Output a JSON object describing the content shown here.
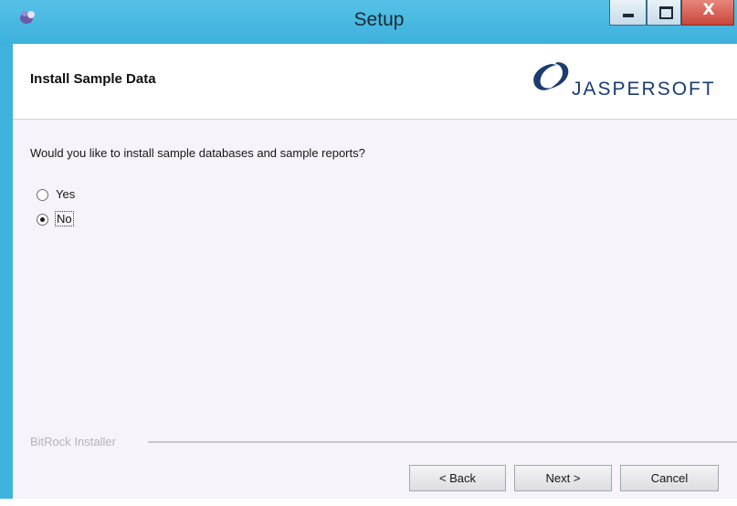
{
  "window": {
    "title": "Setup",
    "close_glyph": "X",
    "app_icon": "installer-app-icon",
    "colors": {
      "titlebar": "#3db1dd",
      "close_button": "#c9463a",
      "body": "#f6f3fa"
    }
  },
  "header": {
    "title": "Install Sample Data",
    "logo_text": "JASPERSOFT",
    "logo_icon": "jaspersoft-swirl-logo",
    "logo_color": "#1a3c6e"
  },
  "content": {
    "question": "Would you like to install sample databases and sample reports?",
    "options": [
      {
        "label": "Yes",
        "selected": false
      },
      {
        "label": "No",
        "selected": true
      }
    ]
  },
  "footer": {
    "brand": "BitRock Installer",
    "buttons": {
      "back": "< Back",
      "next": "Next >",
      "cancel": "Cancel"
    }
  }
}
